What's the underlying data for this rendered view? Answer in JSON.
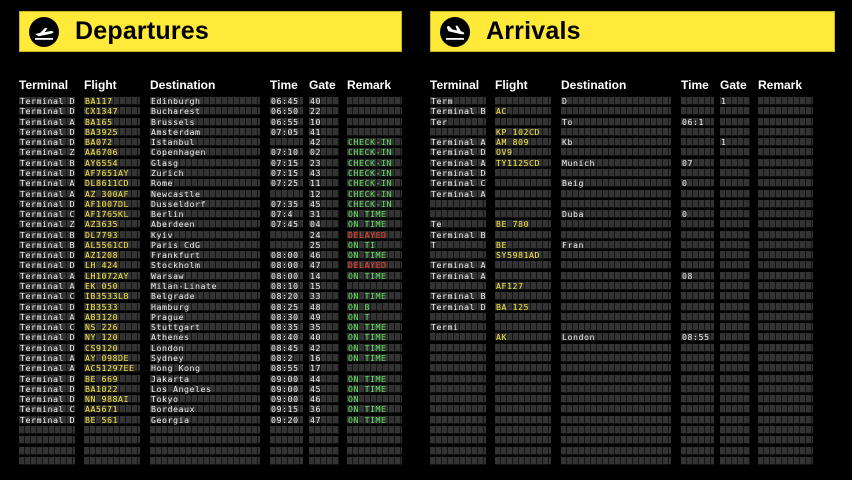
{
  "departures": {
    "title": "Departures",
    "icon": "plane-takeoff-icon",
    "columns": [
      "Terminal",
      "Flight",
      "Destination",
      "Time",
      "Gate",
      "Remark"
    ],
    "rows": [
      [
        "Terminal D",
        "BA117",
        "Edinburgh",
        "06:45",
        "40",
        ""
      ],
      [
        "Terminal D",
        "CX1347",
        "Bucharest",
        "06:50",
        "22",
        ""
      ],
      [
        "Terminal A",
        "BA165",
        "Brussels",
        "06:55",
        "10",
        ""
      ],
      [
        "Terminal D",
        "BA3925",
        "Amsterdam",
        "07:05",
        "41",
        ""
      ],
      [
        "Terminal D",
        "BA072",
        "Istanbul",
        "",
        "42",
        "CHECK-IN"
      ],
      [
        "Terminal Z",
        "AA6706",
        "Copenhagen",
        "07:10",
        "02",
        "CHECK-IN"
      ],
      [
        "Terminal B",
        "AY6554",
        "Glasg",
        "07:15",
        "23",
        "CHECK-IN"
      ],
      [
        "Terminal D",
        "AF7651AY",
        "Zurich",
        "07:15",
        "43",
        "CHECK-IN"
      ],
      [
        "Terminal A",
        "DL8611CD",
        "Rome",
        "07:25",
        "11",
        "CHECK-IN"
      ],
      [
        "Terminal A",
        "AZ 300AF",
        "Newcastle",
        "",
        "12",
        "CHECK-IN"
      ],
      [
        "Terminal D",
        "AF1007DL",
        "Dusseldorf",
        "07:35",
        "45",
        "CHECK-IN"
      ],
      [
        "Terminal C",
        "AF1765KL",
        "Berlin",
        "07:4",
        "31",
        "ON TIME"
      ],
      [
        "Terminal Z",
        "AZ3635",
        "Aberdeen",
        "07:45",
        "04",
        "ON TIME"
      ],
      [
        "Terminal B",
        "DL7793",
        "Kyiv",
        "",
        "24",
        "DELAYED"
      ],
      [
        "Terminal B",
        "AL5561CD",
        "Paris CdG",
        "",
        "25",
        "ON TI"
      ],
      [
        "Terminal D",
        "AZ1208",
        "Frankfurt",
        "08:00",
        "46",
        "ON TIME"
      ],
      [
        "Terminal D",
        "LH 424",
        "Stockholm",
        "08:00",
        "47",
        "DELAYED"
      ],
      [
        "Terminal A",
        "LH1072AY",
        "Warsaw",
        "08:00",
        "14",
        "ON TIME"
      ],
      [
        "Terminal A",
        "EK 050",
        "Milan-Linate",
        "08:10",
        "15",
        ""
      ],
      [
        "Terminal C",
        "IB3533LB",
        "Belgrade",
        "08:20",
        "33",
        "ON TIME"
      ],
      [
        "Terminal D",
        "IB3533",
        "Hamburg",
        "08:25",
        "48",
        "ON B"
      ],
      [
        "Terminal A",
        "AB3120",
        "Prague",
        "08:30",
        "49",
        "ON T"
      ],
      [
        "Terminal C",
        "NS 226",
        "Stuttgart",
        "08:35",
        "35",
        "ON TIME"
      ],
      [
        "Terminal D",
        "NY 120",
        "Athenes",
        "08:40",
        "40",
        "ON TIME"
      ],
      [
        "Terminal D",
        "CS9120",
        "London",
        "08:45",
        "42",
        "ON TIME"
      ],
      [
        "Terminal A",
        "AY 098DE",
        "Sydney",
        "08:2",
        "16",
        "ON TIME"
      ],
      [
        "Terminal A",
        "AC51297EE",
        "Hong Kong",
        "08:55",
        "17",
        ""
      ],
      [
        "Terminal D",
        "BE 669",
        "Jakarta",
        "09:00",
        "44",
        "ON TIME"
      ],
      [
        "Terminal D",
        "BA1022",
        "Los Angeles",
        "09:00",
        "45",
        "ON TIME"
      ],
      [
        "Terminal D",
        "NN 988AI",
        "Tokyo",
        "09:00",
        "46",
        "ON"
      ],
      [
        "Terminal C",
        "AA5671",
        "Bordeaux",
        "09:15",
        "36",
        "ON TIME"
      ],
      [
        "Terminal D",
        "BE 561",
        "Georgia",
        "09:20",
        "47",
        "ON TIME"
      ]
    ]
  },
  "arrivals": {
    "title": "Arrivals",
    "icon": "plane-landing-icon",
    "columns": [
      "Terminal",
      "Flight",
      "Destination",
      "Time",
      "Gate",
      "Remark"
    ],
    "rows": [
      [
        "Term",
        "",
        "D",
        "",
        "1",
        ""
      ],
      [
        "Terminal B",
        "AC",
        "",
        "",
        "",
        ""
      ],
      [
        "Ter",
        "",
        "To",
        "06:1",
        "",
        ""
      ],
      [
        "",
        "KP 102CD",
        "",
        "",
        "",
        ""
      ],
      [
        "Terminal A",
        "AM 809",
        "Kb",
        "",
        "1",
        ""
      ],
      [
        "Terminal D",
        "OV9",
        "",
        "",
        "",
        ""
      ],
      [
        "Terminal A",
        "TY1125CD",
        "Munich",
        "07",
        "",
        ""
      ],
      [
        "Terminal D",
        "",
        "",
        "",
        "",
        ""
      ],
      [
        "Terminal C",
        "",
        "Beig",
        "0",
        "",
        ""
      ],
      [
        "Terminal A",
        "",
        "",
        "",
        "",
        ""
      ],
      [
        "",
        "",
        "",
        "",
        "",
        ""
      ],
      [
        "",
        "",
        "Duba",
        "0",
        "",
        ""
      ],
      [
        "Te",
        "BE 780",
        "",
        "",
        "",
        ""
      ],
      [
        "Terminal B",
        "",
        "",
        "",
        "",
        ""
      ],
      [
        "T",
        "BE",
        "Fran",
        "",
        "",
        ""
      ],
      [
        "",
        "SY5981AD",
        "",
        "",
        "",
        ""
      ],
      [
        "Terminal A",
        "",
        "",
        "",
        "",
        ""
      ],
      [
        "Terminal A",
        "",
        "",
        "08",
        "",
        ""
      ],
      [
        "",
        "AF127",
        "",
        "",
        "",
        ""
      ],
      [
        "Terminal B",
        "",
        "",
        "",
        "",
        ""
      ],
      [
        "Terminal D",
        "BA 125",
        "",
        "",
        "",
        ""
      ],
      [
        "",
        "",
        "",
        "",
        "",
        ""
      ],
      [
        "Termi",
        "",
        "",
        "",
        "",
        ""
      ],
      [
        "",
        "AK",
        "London",
        "08:55",
        "",
        ""
      ],
      [
        "",
        "",
        "",
        "",
        "",
        ""
      ],
      [
        "",
        "",
        "",
        "",
        "",
        ""
      ],
      [
        "",
        "",
        "",
        "",
        "",
        ""
      ],
      [
        "",
        "",
        "",
        "",
        "",
        ""
      ],
      [
        "",
        "",
        "",
        "",
        "",
        ""
      ],
      [
        "",
        "",
        "",
        "",
        "",
        ""
      ],
      [
        "",
        "",
        "",
        "",
        "",
        ""
      ],
      [
        "",
        "",
        "",
        "",
        "",
        ""
      ]
    ]
  },
  "colors": {
    "banner": "#ffea3a",
    "flight_text": "#f4e43f",
    "status_ok": "#5ce05c",
    "status_delayed": "#ff3a2a"
  }
}
